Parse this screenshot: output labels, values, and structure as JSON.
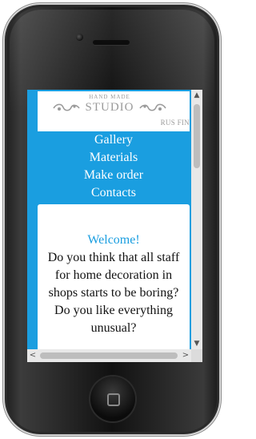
{
  "site": {
    "logo": {
      "top_text": "HAND MADE",
      "main_text": "STUDIO"
    },
    "language_switch": "RUS FIN",
    "nav": {
      "items": [
        {
          "label": "Gallery"
        },
        {
          "label": "Materials"
        },
        {
          "label": "Make order"
        },
        {
          "label": "Contacts"
        }
      ]
    },
    "content": {
      "welcome": "Welcome!",
      "intro": "Do you think that all staff for home decoration in shops starts to be boring? Do you like everything unusual?"
    }
  },
  "scrollbar": {
    "up": "▲",
    "down": "▼",
    "left": "<",
    "right": ">"
  },
  "colors": {
    "accent": "#1a9ee0",
    "phone_body": "#111111",
    "logo_gray": "#9a9a9a"
  },
  "icons": [
    "camera-icon",
    "home-button-icon",
    "scroll-up-icon",
    "scroll-down-icon",
    "scroll-left-icon",
    "scroll-right-icon",
    "logo-swirl-icon"
  ]
}
